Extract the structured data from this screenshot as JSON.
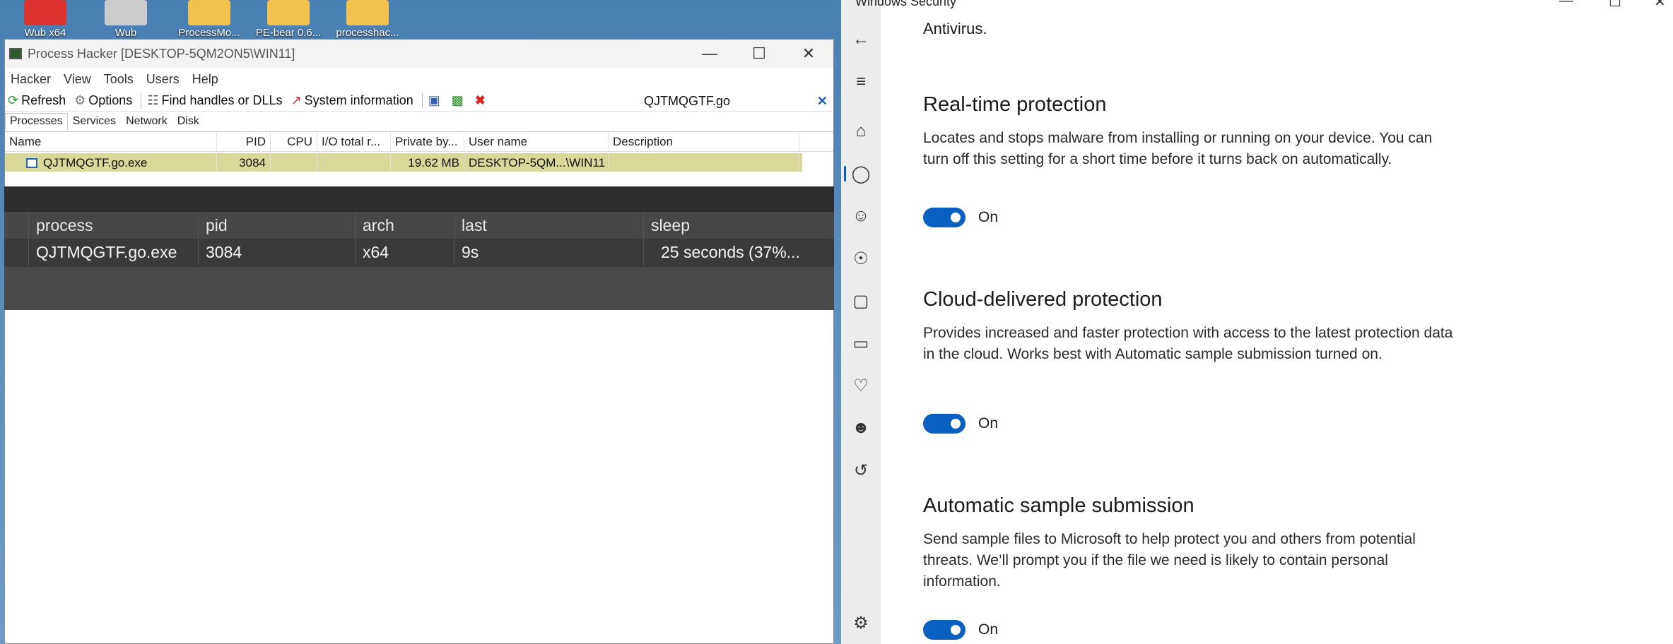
{
  "desktop": {
    "icons": [
      {
        "label": "Wub x64"
      },
      {
        "label": "Wub"
      },
      {
        "label": "ProcessMo..."
      },
      {
        "label": "PE-bear 0.6..."
      },
      {
        "label": "processhac..."
      }
    ]
  },
  "process_hacker": {
    "title": "Process Hacker [DESKTOP-5QM2ON5\\WIN11]",
    "menu": [
      "Hacker",
      "View",
      "Tools",
      "Users",
      "Help"
    ],
    "toolbar": {
      "refresh": "Refresh",
      "options": "Options",
      "find_handles": "Find handles or DLLs",
      "system_info": "System information"
    },
    "search_value": "QJTMQGTF.go",
    "tabs": [
      "Processes",
      "Services",
      "Network",
      "Disk"
    ],
    "columns": [
      "Name",
      "PID",
      "CPU",
      "I/O total r...",
      "Private by...",
      "User name",
      "Description"
    ],
    "rows": [
      {
        "name": "QJTMQGTF.go.exe",
        "pid": "3084",
        "cpu": "",
        "io": "",
        "private": "19.62 MB",
        "user": "DESKTOP-5QM...\\WIN11",
        "description": ""
      }
    ]
  },
  "overlay": {
    "columns": [
      "process",
      "pid",
      "arch",
      "last",
      "sleep"
    ],
    "rows": [
      {
        "process": "QJTMQGTF.go.exe",
        "pid": "3084",
        "arch": "x64",
        "last": "9s",
        "sleep": "25 seconds (37%..."
      }
    ]
  },
  "windows_security": {
    "title": "Windows Security",
    "top_text": "Antivirus.",
    "sections": [
      {
        "heading": "Real-time protection",
        "body": "Locates and stops malware from installing or running on your device. You can turn off this setting for a short time before it turns back on automatically.",
        "toggle": "On"
      },
      {
        "heading": "Cloud-delivered protection",
        "body": "Provides increased and faster protection with access to the latest protection data in the cloud. Works best with Automatic sample submission turned on.",
        "toggle": "On"
      },
      {
        "heading": "Automatic sample submission",
        "body": "Send sample files to Microsoft to help protect you and others from potential threats. We’ll prompt you if the file we need is likely to contain personal information.",
        "toggle": "On"
      }
    ]
  }
}
